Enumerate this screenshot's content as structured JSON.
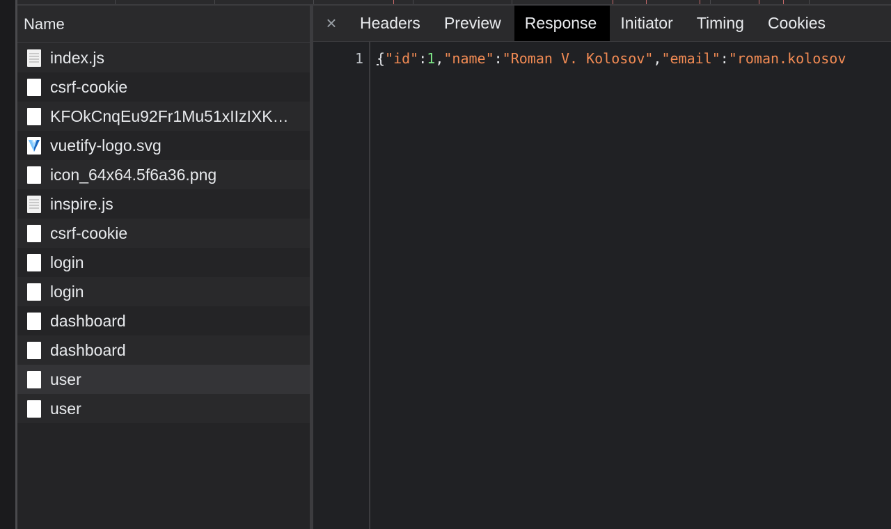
{
  "name_column": {
    "header": "Name",
    "files": [
      {
        "name": "index.js",
        "icon": "script-file-icon"
      },
      {
        "name": "csrf-cookie",
        "icon": "document-icon"
      },
      {
        "name": "KFOkCnqEu92Fr1Mu51xIIzIXK…",
        "icon": "document-icon"
      },
      {
        "name": "vuetify-logo.svg",
        "icon": "vuetify-logo-icon"
      },
      {
        "name": "icon_64x64.5f6a36.png",
        "icon": "document-icon"
      },
      {
        "name": "inspire.js",
        "icon": "script-file-icon"
      },
      {
        "name": "csrf-cookie",
        "icon": "document-icon"
      },
      {
        "name": "login",
        "icon": "document-icon"
      },
      {
        "name": "login",
        "icon": "document-icon"
      },
      {
        "name": "dashboard",
        "icon": "document-icon"
      },
      {
        "name": "dashboard",
        "icon": "document-icon"
      },
      {
        "name": "user",
        "icon": "document-icon"
      },
      {
        "name": "user",
        "icon": "document-icon"
      }
    ]
  },
  "detail": {
    "close_symbol": "×",
    "tabs": [
      "Headers",
      "Preview",
      "Response",
      "Initiator",
      "Timing",
      "Cookies"
    ],
    "selected_tab": "Response",
    "response": {
      "line_number": "1",
      "open_brace": "{",
      "key_id": "\"id\"",
      "colon1": ":",
      "value_id": "1",
      "comma1": ",",
      "key_name": "\"name\"",
      "colon2": ":",
      "value_name": "\"Roman V. Kolosov\"",
      "comma2": ",",
      "key_email": "\"email\"",
      "colon3": ":",
      "value_email_partial": "\"roman.kolosov"
    }
  },
  "colors": {
    "background": "#202124",
    "string_token": "#f28b54",
    "number_token": "#7ee787",
    "selected_tab_bg": "#000000"
  }
}
